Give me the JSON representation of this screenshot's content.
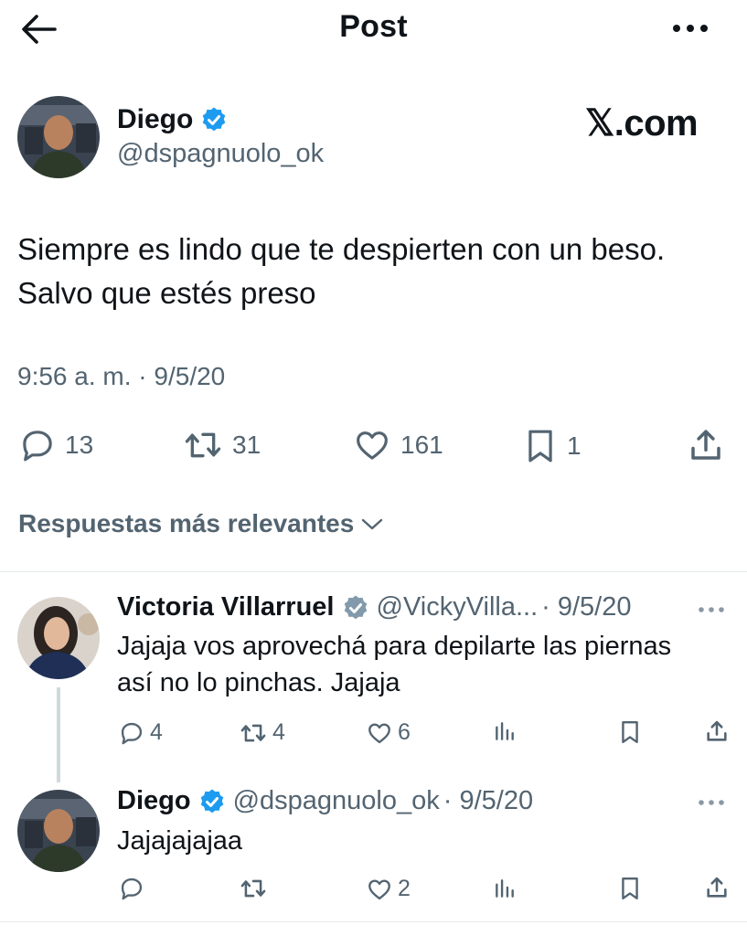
{
  "header": {
    "title": "Post"
  },
  "post": {
    "author_name": "Diego",
    "author_handle": "@dspagnuolo_ok",
    "watermark": "𝕏.com",
    "text_line1": "Siempre es lindo que te despierten con un beso.",
    "text_line2": "Salvo que estés preso",
    "time": "9:56 a. m. · 9/5/20",
    "stats": {
      "replies": "13",
      "reposts": "31",
      "likes": "161",
      "bookmarks": "1"
    }
  },
  "replies_sort_label": "Respuestas más relevantes",
  "replies": [
    {
      "author_name": "Victoria Villarruel",
      "author_handle": "@VickyVilla...",
      "date": "· 9/5/20",
      "text_line1": "Jajaja vos aprovechá para depilarte las piernas",
      "text_line2": "así no lo pinchas. Jajaja",
      "stats": {
        "replies": "4",
        "reposts": "4",
        "likes": "6"
      }
    },
    {
      "author_name": "Diego",
      "author_handle": "@dspagnuolo_ok",
      "date": "· 9/5/20",
      "text": "Jajajajajaa",
      "stats": {
        "likes": "2"
      }
    }
  ],
  "colors": {
    "text": "#0f1419",
    "muted": "#536471",
    "verified": "#1d9bf0",
    "divider": "#e6e9eb"
  },
  "icons": [
    "back-arrow-icon",
    "more-icon",
    "verified-icon",
    "reply-icon",
    "repost-icon",
    "like-icon",
    "bookmark-icon",
    "share-icon",
    "views-icon",
    "chevron-down-icon"
  ]
}
